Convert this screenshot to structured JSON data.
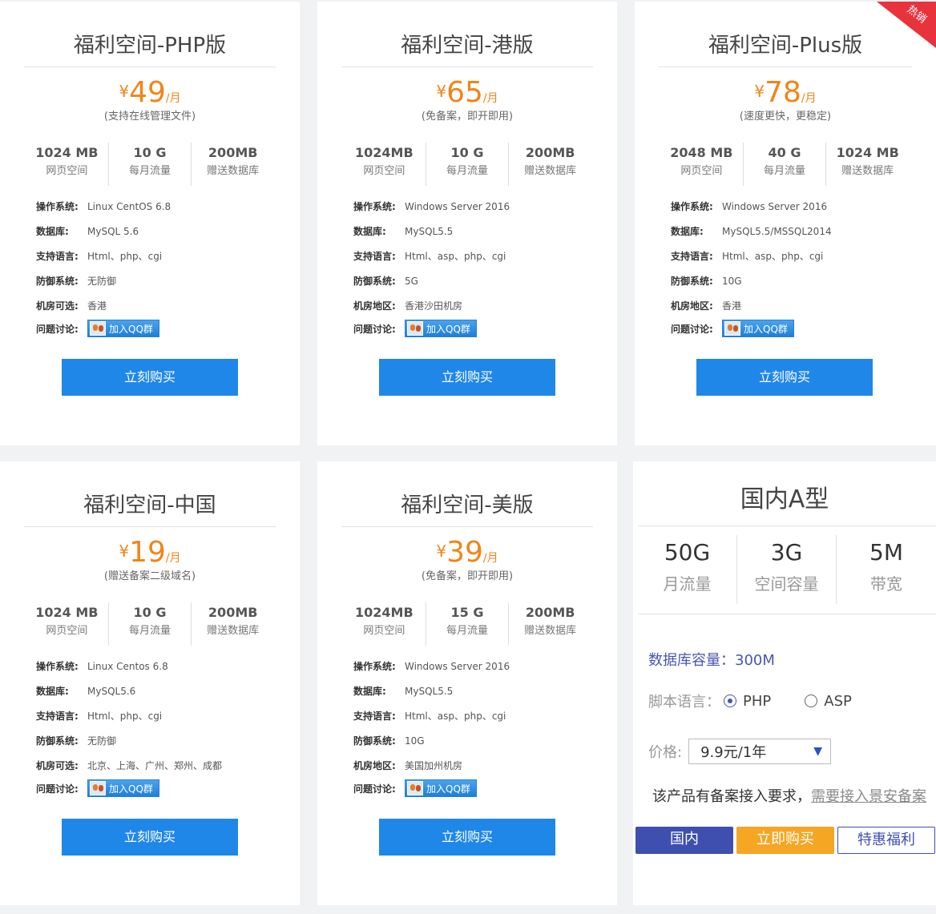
{
  "cards": [
    {
      "title": "福利空间-PHP版",
      "currency": "¥",
      "price": "49",
      "unit": "/月",
      "note": "(支持在线管理文件)",
      "specs": [
        {
          "v": "1024 MB",
          "k": "网页空间"
        },
        {
          "v": "10 G",
          "k": "每月流量"
        },
        {
          "v": "200MB",
          "k": "赠送数据库"
        }
      ],
      "rows": [
        {
          "l": "操作系统:",
          "v": "Linux CentOS 6.8"
        },
        {
          "l": "数据库:",
          "v": "MySQL 5.6"
        },
        {
          "l": "支持语言:",
          "v": "Html、php、cgi"
        },
        {
          "l": "防御系统:",
          "v": "无防御"
        },
        {
          "l": "机房可选:",
          "v": "香港"
        }
      ],
      "qq_label": "问题讨论:",
      "qq_button": "加入QQ群",
      "buy": "立刻购买"
    },
    {
      "title": "福利空间-港版",
      "currency": "¥",
      "price": "65",
      "unit": "/月",
      "note": "(免备案，即开即用)",
      "specs": [
        {
          "v": "1024MB",
          "k": "网页空间"
        },
        {
          "v": "10 G",
          "k": "每月流量"
        },
        {
          "v": "200MB",
          "k": "赠送数据库"
        }
      ],
      "rows": [
        {
          "l": "操作系统:",
          "v": "Windows Server 2016"
        },
        {
          "l": "数据库:",
          "v": "MySQL5.5"
        },
        {
          "l": "支持语言:",
          "v": "Html、asp、php、cgi"
        },
        {
          "l": "防御系统:",
          "v": "5G"
        },
        {
          "l": "机房地区:",
          "v": "香港沙田机房"
        }
      ],
      "qq_label": "问题讨论:",
      "qq_button": "加入QQ群",
      "buy": "立刻购买"
    },
    {
      "title": "福利空间-Plus版",
      "currency": "¥",
      "price": "78",
      "unit": "/月",
      "note": "(速度更快，更稳定)",
      "badge": "热销",
      "specs": [
        {
          "v": "2048 MB",
          "k": "网页空间"
        },
        {
          "v": "40 G",
          "k": "每月流量"
        },
        {
          "v": "1024 MB",
          "k": "赠送数据库"
        }
      ],
      "rows": [
        {
          "l": "操作系统:",
          "v": "Windows Server 2016"
        },
        {
          "l": "数据库:",
          "v": "MySQL5.5/MSSQL2014"
        },
        {
          "l": "支持语言:",
          "v": "Html、asp、php、cgi"
        },
        {
          "l": "防御系统:",
          "v": "10G"
        },
        {
          "l": "机房地区:",
          "v": "香港"
        }
      ],
      "qq_label": "问题讨论:",
      "qq_button": "加入QQ群",
      "buy": "立刻购买"
    },
    {
      "title": "福利空间-中国",
      "currency": "¥",
      "price": "19",
      "unit": "/月",
      "note": "(赠送备案二级域名)",
      "specs": [
        {
          "v": "1024 MB",
          "k": "网页空间"
        },
        {
          "v": "10 G",
          "k": "每月流量"
        },
        {
          "v": "200MB",
          "k": "赠送数据库"
        }
      ],
      "rows": [
        {
          "l": "操作系统:",
          "v": "Linux Centos 6.8"
        },
        {
          "l": "数据库:",
          "v": "MySQL5.6"
        },
        {
          "l": "支持语言:",
          "v": "Html、php、cgi"
        },
        {
          "l": "防御系统:",
          "v": "无防御"
        },
        {
          "l": "机房可选:",
          "v": "北京、上海、广州、郑州、成都"
        }
      ],
      "qq_label": "问题讨论:",
      "qq_button": "加入QQ群",
      "buy": "立刻购买"
    },
    {
      "title": "福利空间-美版",
      "currency": "¥",
      "price": "39",
      "unit": "/月",
      "note": "(免备案，即开即用)",
      "specs": [
        {
          "v": "1024MB",
          "k": "网页空间"
        },
        {
          "v": "15 G",
          "k": "每月流量"
        },
        {
          "v": "200MB",
          "k": "赠送数据库"
        }
      ],
      "rows": [
        {
          "l": "操作系统:",
          "v": "Windows Server 2016"
        },
        {
          "l": "数据库:",
          "v": "MySQL5.5"
        },
        {
          "l": "支持语言:",
          "v": "Html、asp、php、cgi"
        },
        {
          "l": "防御系统:",
          "v": "10G"
        },
        {
          "l": "机房地区:",
          "v": "美国加州机房"
        }
      ],
      "qq_label": "问题讨论:",
      "qq_button": "加入QQ群",
      "buy": "立刻购买"
    }
  ],
  "domestic": {
    "title": "国内A型",
    "stats": [
      {
        "v": "50G",
        "k": "月流量"
      },
      {
        "v": "3G",
        "k": "空间容量"
      },
      {
        "v": "5M",
        "k": "带宽"
      }
    ],
    "db": "数据库容量：300M",
    "lang_label": "脚本语言：",
    "lang_options": [
      "PHP",
      "ASP"
    ],
    "price_label": "价格:",
    "price_selected": "9.9元/1年",
    "requirement": "该产品有备案接入要求，",
    "requirement_link": "需要接入景安备案",
    "btn_domestic": "国内",
    "btn_buy": "立即购买",
    "btn_gift": "特惠福利"
  },
  "colors": {
    "accent_blue": "#1f87e8",
    "price_orange": "#f08519",
    "badge_red": "#e8323c",
    "indigo": "#3f4fb0",
    "buy_orange": "#f5a623"
  }
}
